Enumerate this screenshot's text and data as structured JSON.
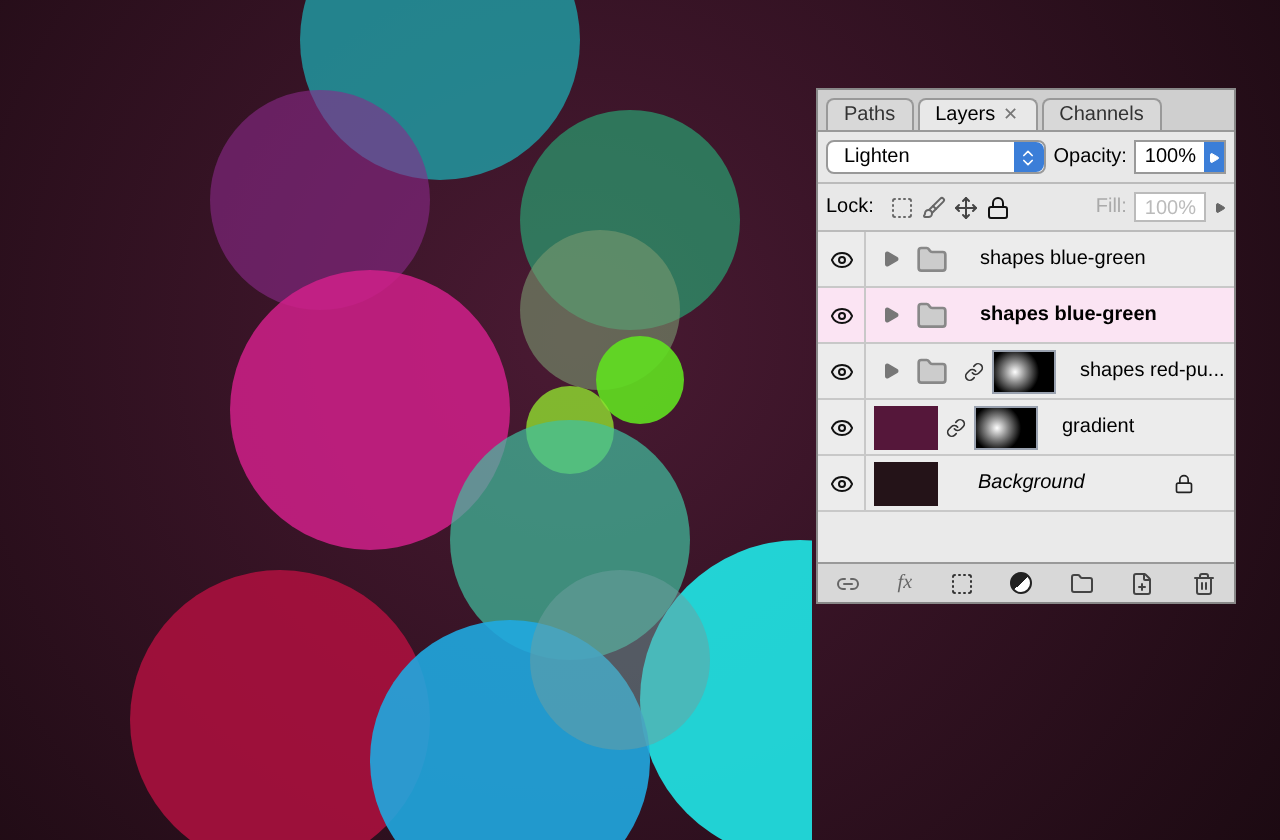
{
  "panel": {
    "tabs": [
      {
        "label": "Paths",
        "selected": false
      },
      {
        "label": "Layers",
        "selected": true,
        "closable": true,
        "close_glyph": "✕"
      },
      {
        "label": "Channels",
        "selected": false
      }
    ],
    "blend_mode": "Lighten",
    "opacity_label": "Opacity:",
    "opacity": "100%",
    "lock_label": "Lock:",
    "fill_label": "Fill:",
    "fill": "100%",
    "fill_disabled": true,
    "layers": [
      {
        "kind": "group",
        "name": "shapes blue-green",
        "visible": true,
        "selected": false,
        "expanded": false,
        "mask": false
      },
      {
        "kind": "group",
        "name": "shapes blue-green",
        "visible": true,
        "selected": true,
        "expanded": false,
        "mask": false
      },
      {
        "kind": "group",
        "name": "shapes red-pu...",
        "visible": true,
        "selected": false,
        "expanded": false,
        "mask": true
      },
      {
        "kind": "fill",
        "name": "gradient",
        "visible": true,
        "selected": false,
        "color": "#55173a",
        "mask": true
      },
      {
        "kind": "background",
        "name": "Background",
        "visible": true,
        "selected": false,
        "color": "#241318",
        "mask": false,
        "locked": true
      }
    ],
    "fx_label": "fx"
  }
}
